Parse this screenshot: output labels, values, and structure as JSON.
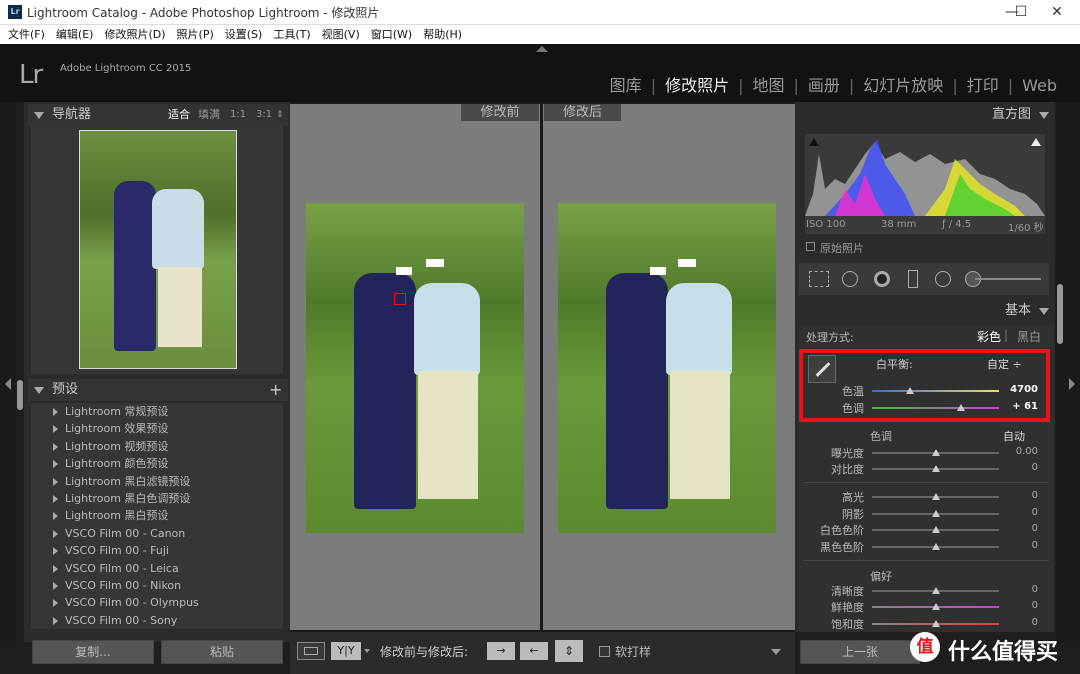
{
  "window": {
    "title": "Lightroom Catalog - Adobe Photoshop Lightroom - 修改照片",
    "app_icon": "Lr",
    "minimize": "—",
    "maximize": "☐",
    "close": "✕"
  },
  "menu": [
    "文件(F)",
    "编辑(E)",
    "修改照片(D)",
    "照片(P)",
    "设置(S)",
    "工具(T)",
    "视图(V)",
    "窗口(W)",
    "帮助(H)"
  ],
  "brand": {
    "logo": "Lr",
    "version": "Adobe Lightroom CC 2015"
  },
  "modules": [
    "图库",
    "修改照片",
    "地图",
    "画册",
    "幻灯片放映",
    "打印",
    "Web"
  ],
  "navigator": {
    "title": "导航器",
    "zoom": [
      "适合",
      "填满",
      "1:1",
      "3:1"
    ]
  },
  "presets": {
    "title": "预设",
    "add": "+",
    "items": [
      "Lightroom 常规预设",
      "Lightroom 效果预设",
      "Lightroom 视频预设",
      "Lightroom 颜色预设",
      "Lightroom 黑白滤镜预设",
      "Lightroom 黑白色调预设",
      "Lightroom 黑白预设",
      "VSCO Film 00 - Canon",
      "VSCO Film 00 - Fuji",
      "VSCO Film 00 - Leica",
      "VSCO Film 00 - Nikon",
      "VSCO Film 00 - Olympus",
      "VSCO Film 00 - Sony"
    ]
  },
  "left_buttons": {
    "copy": "复制...",
    "paste": "粘贴"
  },
  "compare": {
    "before": "修改前",
    "after": "修改后"
  },
  "toolbar": {
    "yy": "Y|Y",
    "label": "修改前与修改后:",
    "softproof": "软打样"
  },
  "histogram": {
    "title": "直方图",
    "iso": "ISO 100",
    "focal": "38 mm",
    "aperture": "ƒ / 4.5",
    "shutter": "1/60 秒",
    "original": "原始照片"
  },
  "basic": {
    "title": "基本",
    "treatment_label": "处理方式:",
    "color": "彩色",
    "bw": "黑白",
    "wb_label": "白平衡:",
    "wb_value": "自定 ÷",
    "temp": {
      "label": "色温",
      "value": "4700",
      "level": 0.3
    },
    "tint": {
      "label": "色调",
      "value": "+ 61",
      "level": 0.7
    },
    "tone_label": "色调",
    "auto": "自动",
    "exposure": {
      "label": "曝光度",
      "value": "0.00",
      "level": 0.5
    },
    "contrast": {
      "label": "对比度",
      "value": "0",
      "level": 0.5
    },
    "highlights": {
      "label": "高光",
      "value": "0",
      "level": 0.5
    },
    "shadows": {
      "label": "阴影",
      "value": "0",
      "level": 0.5
    },
    "whites": {
      "label": "白色色阶",
      "value": "0",
      "level": 0.5
    },
    "blacks": {
      "label": "黑色色阶",
      "value": "0",
      "level": 0.5
    },
    "presence_label": "偏好",
    "clarity": {
      "label": "清晰度",
      "value": "0",
      "level": 0.5
    },
    "vibrance": {
      "label": "鲜艳度",
      "value": "0",
      "level": 0.5
    },
    "saturation": {
      "label": "饱和度",
      "value": "0",
      "level": 0.5
    }
  },
  "right_buttons": {
    "prev": "上一张"
  },
  "watermark": {
    "text": "什么值得买",
    "badge": "值"
  },
  "colors": {
    "highlight_border": "#e8141c",
    "accent": "#eeeeee"
  }
}
